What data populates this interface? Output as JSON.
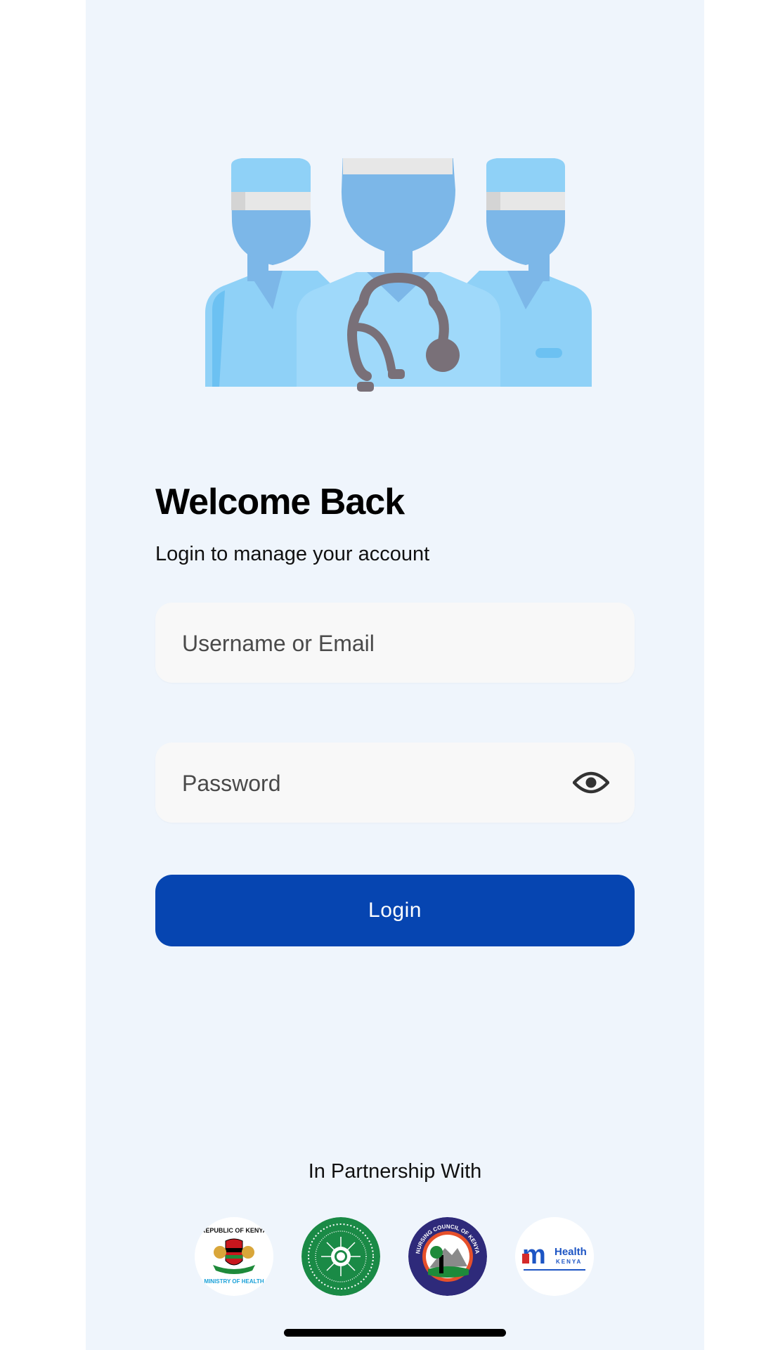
{
  "header": {
    "title": "Welcome Back",
    "subtitle": "Login to manage your account"
  },
  "form": {
    "username_placeholder": "Username or Email",
    "password_placeholder": "Password",
    "login_label": "Login"
  },
  "icons": {
    "hero": "medical-team-illustration",
    "password_toggle": "eye-icon"
  },
  "footer": {
    "partnership_label": "In Partnership With",
    "partners": [
      {
        "name": "moh",
        "text_top": "REPUBLIC OF KENYA",
        "text_bottom": "MINISTRY OF HEALTH"
      },
      {
        "name": "green-seal"
      },
      {
        "name": "nck",
        "text": "NURSING COUNCIL OF KENYA"
      },
      {
        "name": "mhealth",
        "text_main": "Health",
        "text_sub": "KENYA"
      }
    ]
  },
  "colors": {
    "background": "#eff5fc",
    "primary": "#0645b1",
    "field": "#f8f8f8"
  }
}
